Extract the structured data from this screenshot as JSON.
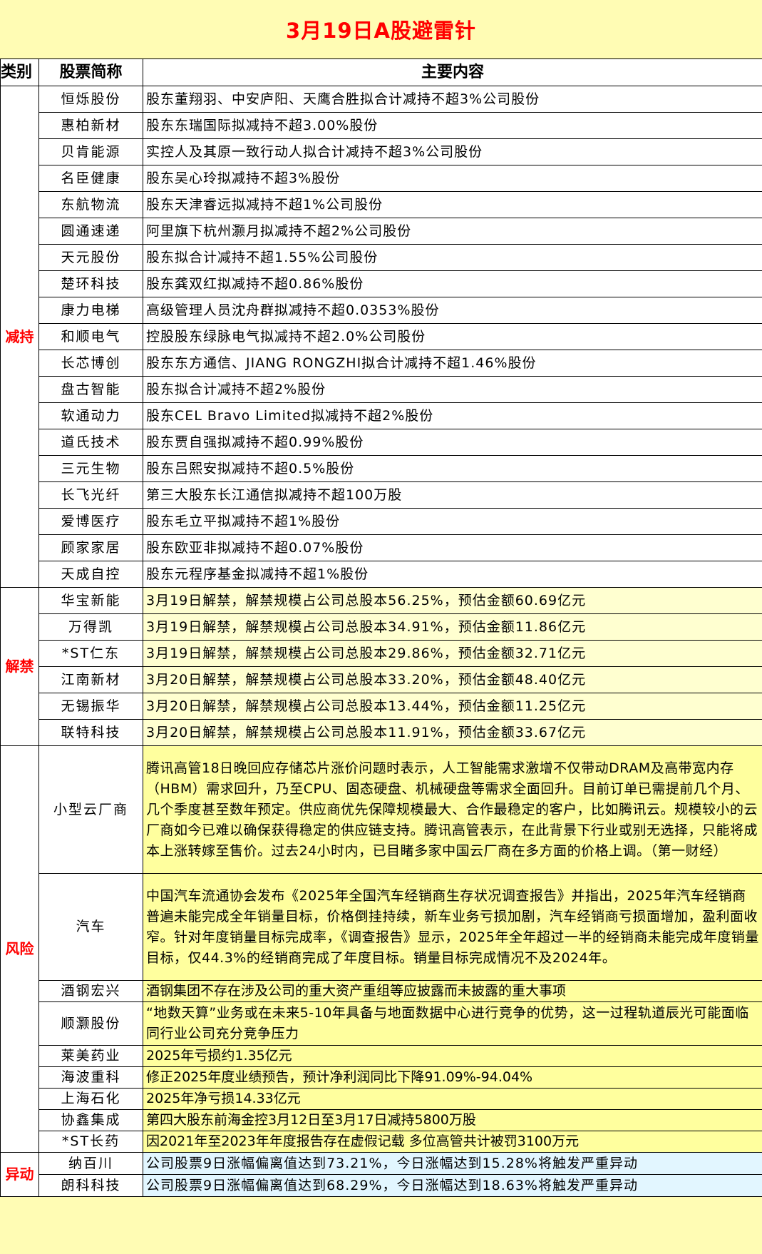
{
  "title": "3月19日A股避雷针",
  "headers": {
    "category": "类别",
    "name": "股票简称",
    "content": "主要内容"
  },
  "reduce": {
    "category": "减持",
    "rows": [
      {
        "name": "恒烁股份",
        "content": "股东董翔羽、中安庐阳、天鹰合胜拟合计减持不超3%公司股份"
      },
      {
        "name": "惠柏新材",
        "content": "股东东瑞国际拟减持不超3.00%股份"
      },
      {
        "name": "贝肯能源",
        "content": "实控人及其原一致行动人拟合计减持不超3%公司股份"
      },
      {
        "name": "名臣健康",
        "content": "股东吴心玲拟减持不超3%股份"
      },
      {
        "name": "东航物流",
        "content": "股东天津睿远拟减持不超1%公司股份"
      },
      {
        "name": "圆通速递",
        "content": "阿里旗下杭州灏月拟减持不超2%公司股份"
      },
      {
        "name": "天元股份",
        "content": "股东拟合计减持不超1.55%公司股份"
      },
      {
        "name": "楚环科技",
        "content": "股东龚双红拟减持不超0.86%股份"
      },
      {
        "name": "康力电梯",
        "content": "高级管理人员沈舟群拟减持不超0.0353%股份"
      },
      {
        "name": "和顺电气",
        "content": "控股股东绿脉电气拟减持不超2.0%公司股份"
      },
      {
        "name": "长芯博创",
        "content": "股东东方通信、JIANG RONGZHI拟合计减持不超1.46%股份"
      },
      {
        "name": "盘古智能",
        "content": "股东拟合计减持不超2%股份"
      },
      {
        "name": "软通动力",
        "content": "股东CEL Bravo Limited拟减持不超2%股份"
      },
      {
        "name": "道氏技术",
        "content": "股东贾自强拟减持不超0.99%股份"
      },
      {
        "name": "三元生物",
        "content": "股东吕熙安拟减持不超0.5%股份"
      },
      {
        "name": "长飞光纤",
        "content": "第三大股东长江通信拟减持不超100万股"
      },
      {
        "name": "爱博医疗",
        "content": "股东毛立平拟减持不超1%股份"
      },
      {
        "name": "顾家家居",
        "content": "股东欧亚非拟减持不超0.07%股份"
      },
      {
        "name": "天成自控",
        "content": "股东元程序基金拟减持不超1%股份"
      }
    ]
  },
  "unlock": {
    "category": "解禁",
    "rows": [
      {
        "name": "华宝新能",
        "content": "3月19日解禁，解禁规模占公司总股本56.25%，预估金额60.69亿元"
      },
      {
        "name": "万得凯",
        "content": "3月19日解禁，解禁规模占公司总股本34.91%，预估金额11.86亿元"
      },
      {
        "name": "*ST仁东",
        "content": "3月19日解禁，解禁规模占公司总股本29.86%，预估金额32.71亿元"
      },
      {
        "name": "江南新材",
        "content": "3月20日解禁，解禁规模占公司总股本33.20%，预估金额48.40亿元"
      },
      {
        "name": "无锡振华",
        "content": "3月20日解禁，解禁规模占公司总股本13.44%，预估金额11.25亿元"
      },
      {
        "name": "联特科技",
        "content": "3月20日解禁，解禁规模占公司总股本11.91%，预估金额33.67亿元"
      }
    ]
  },
  "risk": {
    "category": "风险",
    "rows": [
      {
        "name": "小型云厂商",
        "content": "腾讯高管18日晚回应存储芯片涨价问题时表示，人工智能需求激增不仅带动DRAM及高带宽内存（HBM）需求回升，乃至CPU、固态硬盘、机械硬盘等需求全面回升。目前订单已需提前几个月、几个季度甚至数年预定。供应商优先保障规模最大、合作最稳定的客户，比如腾讯云。规模较小的云厂商如今已难以确保获得稳定的供应链支持。腾讯高管表示，在此背景下行业或别无选择，只能将成本上涨转嫁至售价。过去24小时内，已目睹多家中国云厂商在多方面的价格上调。（第一财经）"
      },
      {
        "name": "汽车",
        "content": "中国汽车流通协会发布《2025年全国汽车经销商生存状况调查报告》并指出，2025年汽车经销商普遍未能完成全年销量目标，价格倒挂持续，新车业务亏损加剧，汽车经销商亏损面增加，盈利面收窄。针对年度销量目标完成率，《调查报告》显示，2025年全年超过一半的经销商未能完成年度销量目标，仅44.3%的经销商完成了年度目标。销量目标完成情况不及2024年。"
      },
      {
        "name": "酒钢宏兴",
        "content": "酒钢集团不存在涉及公司的重大资产重组等应披露而未披露的重大事项"
      },
      {
        "name": "顺灏股份",
        "content": "“地数天算”业务或在未来5-10年具备与地面数据中心进行竞争的优势，这一过程轨道辰光可能面临同行业公司充分竞争压力"
      },
      {
        "name": "莱美药业",
        "content": "2025年亏损约1.35亿元"
      },
      {
        "name": "海波重科",
        "content": "修正2025年度业绩预告，预计净利润同比下降91.09%-94.04%"
      },
      {
        "name": "上海石化",
        "content": "2025年净亏损14.33亿元"
      },
      {
        "name": "协鑫集成",
        "content": "第四大股东前海金控3月12日至3月17日减持5800万股"
      },
      {
        "name": "*ST长药",
        "content": "因2021年至2023年年度报告存在虚假记载 多位高管共计被罚3100万元"
      }
    ]
  },
  "abnormal": {
    "category": "异动",
    "rows": [
      {
        "name": "纳百川",
        "content": "公司股票9日涨幅偏离值达到73.21%，今日涨幅达到15.28%将触发严重异动"
      },
      {
        "name": "朗科科技",
        "content": "公司股票9日涨幅偏离值达到68.29%，今日涨幅达到18.63%将触发严重异动"
      }
    ]
  }
}
